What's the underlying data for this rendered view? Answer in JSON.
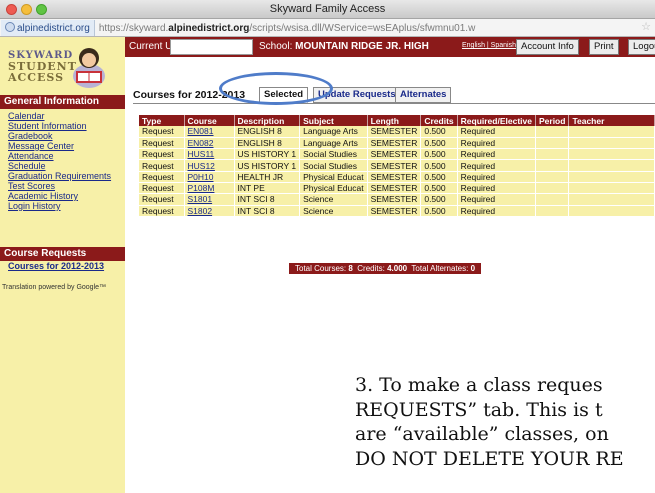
{
  "window": {
    "title": "Skyward Family Access"
  },
  "address": {
    "host": "alpinedistrict.org",
    "url_prefix": "https://skyward.",
    "url_domain": "alpinedistrict.org",
    "url_path": "/scripts/wsisa.dll/WService=wsEAplus/sfwmnu01.w"
  },
  "logo": {
    "line1": "SKYWARD",
    "line2": "STUDENT",
    "line3": "ACCESS"
  },
  "sidebar": {
    "general_heading": "General Information",
    "general_links": [
      "Calendar",
      "Student Information",
      "Gradebook",
      "Message Center",
      "Attendance",
      "Schedule",
      "Graduation Requirements",
      "Test Scores",
      "Academic History",
      "Login History"
    ],
    "course_heading": "Course Requests",
    "course_link": "Courses for 2012-2013",
    "translation_note": "Translation powered by Google™"
  },
  "header": {
    "current_user_label": "Current User",
    "school_label": "School:",
    "school_name": "MOUNTAIN RIDGE JR. HIGH",
    "lang_links": "English | Spanish",
    "buttons": {
      "account_info": "Account Info",
      "print": "Print",
      "logout": "Logout"
    }
  },
  "tabs": {
    "title": "Courses for 2012-2013",
    "items": [
      "Selected",
      "Update Requests",
      "Alternates"
    ],
    "active_index": 0
  },
  "table": {
    "columns": [
      "Type",
      "Course",
      "Description",
      "Subject",
      "Length",
      "Credits",
      "Required/Elective",
      "Period",
      "Teacher"
    ],
    "rows": [
      [
        "Request",
        "EN081",
        "ENGLISH 8",
        "Language Arts",
        "SEMESTER",
        "0.500",
        "Required",
        "",
        ""
      ],
      [
        "Request",
        "EN082",
        "ENGLISH 8",
        "Language Arts",
        "SEMESTER",
        "0.500",
        "Required",
        "",
        ""
      ],
      [
        "Request",
        "HUS11",
        "US HISTORY 1",
        "Social Studies",
        "SEMESTER",
        "0.500",
        "Required",
        "",
        ""
      ],
      [
        "Request",
        "HUS12",
        "US HISTORY 1",
        "Social Studies",
        "SEMESTER",
        "0.500",
        "Required",
        "",
        ""
      ],
      [
        "Request",
        "P0H10",
        "HEALTH JR",
        "Physical Educat",
        "SEMESTER",
        "0.500",
        "Required",
        "",
        ""
      ],
      [
        "Request",
        "P108M",
        "INT PE",
        "Physical Educat",
        "SEMESTER",
        "0.500",
        "Required",
        "",
        ""
      ],
      [
        "Request",
        "S1801",
        "INT SCI 8",
        "Science",
        "SEMESTER",
        "0.500",
        "Required",
        "",
        ""
      ],
      [
        "Request",
        "S1802",
        "INT SCI 8",
        "Science",
        "SEMESTER",
        "0.500",
        "Required",
        "",
        ""
      ]
    ]
  },
  "totals": {
    "courses_label": "Total Courses:",
    "courses_value": "8",
    "credits_label": "Credits:",
    "credits_value": "4.000",
    "alternates_label": "Total Alternates:",
    "alternates_value": "0"
  },
  "document": {
    "lines": [
      "3.  To make a class reques",
      "REQUESTS” tab.   This is t",
      "are “available” classes, on",
      "DO NOT DELETE YOUR RE"
    ]
  },
  "colors": {
    "maroon": "#8b1a1a",
    "sidebar_yellow": "#f7f0a8",
    "link_blue": "#1a2a8a",
    "highlight_ellipse": "#4f7cc9"
  }
}
